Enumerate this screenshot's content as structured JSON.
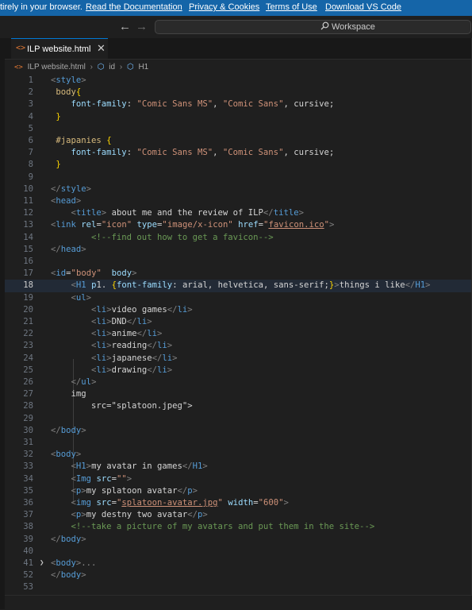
{
  "banner": {
    "lead_text": "tirely in your browser.",
    "links": [
      "Read the Documentation",
      "Privacy & Cookies",
      "Terms of Use",
      "Download VS Code"
    ]
  },
  "titlebar": {
    "back_icon": "arrow-left-icon",
    "forward_icon": "arrow-right-icon",
    "search_icon": "search-icon",
    "command_center_label": "Workspace"
  },
  "tab": {
    "icon": "html-file-icon",
    "label": "ILP website.html",
    "close_glyph": "✕"
  },
  "breadcrumb": {
    "file": "ILP website.html",
    "items": [
      "id",
      "H1"
    ]
  },
  "editor": {
    "active_line": "18",
    "lines": [
      {
        "n": "1",
        "code": "<style>"
      },
      {
        "n": "2",
        "code": " body{"
      },
      {
        "n": "3",
        "code": "    font-family: \"Comic Sans MS\", \"Comic Sans\", cursive;"
      },
      {
        "n": "4",
        "code": " }"
      },
      {
        "n": "5",
        "code": ""
      },
      {
        "n": "6",
        "code": " #japanies {"
      },
      {
        "n": "7",
        "code": "    font-family: \"Comic Sans MS\", \"Comic Sans\", cursive;"
      },
      {
        "n": "8",
        "code": " }"
      },
      {
        "n": "9",
        "code": ""
      },
      {
        "n": "10",
        "code": "</style>"
      },
      {
        "n": "11",
        "code": "<head>"
      },
      {
        "n": "12",
        "code": "    <title> about me and the review of ILP</title>"
      },
      {
        "n": "13",
        "code": "<link rel=\"icon\" type=\"image/x-icon\" href=\"favicon.ico\">"
      },
      {
        "n": "14",
        "code": "        <!--find out how to get a favicon-->"
      },
      {
        "n": "15",
        "code": "</head>"
      },
      {
        "n": "16",
        "code": ""
      },
      {
        "n": "17",
        "code": "<id=\"body\"  body>"
      },
      {
        "n": "18",
        "code": "    <H1 p1. {font-family: arial, helvetica, sans-serif;}>things i like</H1>"
      },
      {
        "n": "19",
        "code": "    <ul>"
      },
      {
        "n": "20",
        "code": "        <li>video games</li>"
      },
      {
        "n": "21",
        "code": "        <li>DND</li>"
      },
      {
        "n": "22",
        "code": "        <li>anime</li>"
      },
      {
        "n": "23",
        "code": "        <li>reading</li>"
      },
      {
        "n": "24",
        "code": "        <li>japanese</li>"
      },
      {
        "n": "25",
        "code": "        <li>drawing</li>"
      },
      {
        "n": "26",
        "code": "    </ul>"
      },
      {
        "n": "27",
        "code": "    <img"
      },
      {
        "n": "28",
        "code": "        src=\"splatoon.jpeg\">"
      },
      {
        "n": "29",
        "code": ""
      },
      {
        "n": "30",
        "code": "</body>"
      },
      {
        "n": "31",
        "code": ""
      },
      {
        "n": "32",
        "code": "<body>"
      },
      {
        "n": "33",
        "code": "    <H1>my avatar in games</H1>"
      },
      {
        "n": "34",
        "code": "    <Img src=\"\">"
      },
      {
        "n": "35",
        "code": "    <p>my splatoon avatar</p>"
      },
      {
        "n": "36",
        "code": "    <img src=\"splatoon-avatar.jpg\" width=\"600\">"
      },
      {
        "n": "37",
        "code": "    <p>my destny two avatar</p>"
      },
      {
        "n": "38",
        "code": "    <!--take a picture of my avatars and put them in the site-->"
      },
      {
        "n": "39",
        "code": "</body>"
      },
      {
        "n": "40",
        "code": ""
      },
      {
        "n": "41",
        "code": "<body>...",
        "folded": true
      },
      {
        "n": "52",
        "code": "</body>"
      },
      {
        "n": "53",
        "code": ""
      }
    ]
  }
}
